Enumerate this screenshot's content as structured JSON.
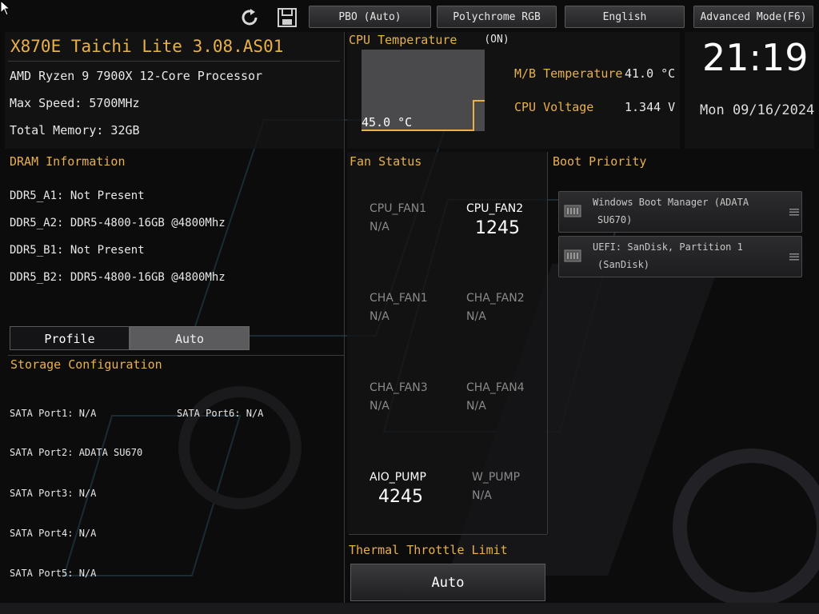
{
  "toolbar": {
    "pbo_label": "PBO (Auto)",
    "rgb_label": "Polychrome RGB (ON)",
    "language_label": "English",
    "mode_label": "Advanced Mode(F6)",
    "refresh_icon": "refresh-icon",
    "save_icon": "save-icon"
  },
  "system": {
    "board_title": "X870E Taichi Lite 3.08.AS01",
    "cpu_model": "AMD Ryzen 9 7900X 12-Core Processor",
    "max_speed": "Max Speed: 5700MHz",
    "total_memory": "Total Memory: 32GB"
  },
  "cpu_temp": {
    "label": "CPU Temperature",
    "value": "45.0 °C"
  },
  "readings": {
    "mb_temp_label": "M/B Temperature",
    "mb_temp_value": "41.0 °C",
    "cpu_voltage_label": "CPU Voltage",
    "cpu_voltage_value": "1.344 V"
  },
  "clock": {
    "time": "21:19",
    "date": "Mon 09/16/2024"
  },
  "dram": {
    "title": "DRAM Information",
    "slots": [
      "DDR5_A1: Not Present",
      "DDR5_A2: DDR5-4800-16GB @4800Mhz",
      "DDR5_B1: Not Present",
      "DDR5_B2: DDR5-4800-16GB @4800Mhz"
    ],
    "profile_label": "Profile",
    "profile_value": "Auto"
  },
  "storage": {
    "title": "Storage Configuration",
    "ports_left": [
      "SATA Port1: N/A",
      "SATA Port2: ADATA SU670",
      "SATA Port3: N/A",
      "SATA Port4: N/A",
      "SATA Port5: N/A"
    ],
    "ports_right": [
      "SATA Port6: N/A"
    ]
  },
  "fans": {
    "title": "Fan Status",
    "cpu_fan1": {
      "name": "CPU_FAN1",
      "value": "N/A"
    },
    "cpu_fan2": {
      "name": "CPU_FAN2",
      "value": "1245"
    },
    "cha_fan1": {
      "name": "CHA_FAN1",
      "value": "N/A"
    },
    "cha_fan2": {
      "name": "CHA_FAN2",
      "value": "N/A"
    },
    "cha_fan3": {
      "name": "CHA_FAN3",
      "value": "N/A"
    },
    "cha_fan4": {
      "name": "CHA_FAN4",
      "value": "N/A"
    },
    "aio_pump": {
      "name": "AIO_PUMP",
      "value": "4245"
    },
    "w_pump": {
      "name": "W_PUMP",
      "value": "N/A"
    }
  },
  "thermal": {
    "title": "Thermal Throttle Limit",
    "value": "Auto"
  },
  "boot": {
    "title": "Boot Priority",
    "items": [
      {
        "line1": "Windows Boot Manager (ADATA",
        "line2": "SU670)",
        "icon": "drive-icon"
      },
      {
        "line1": "UEFI: SanDisk, Partition 1",
        "line2": "(SanDisk)",
        "icon": "drive-icon"
      }
    ]
  },
  "colors": {
    "accent": "#e8b14a",
    "background": "#0c0c0d",
    "dim_text": "#8a8a8a"
  }
}
